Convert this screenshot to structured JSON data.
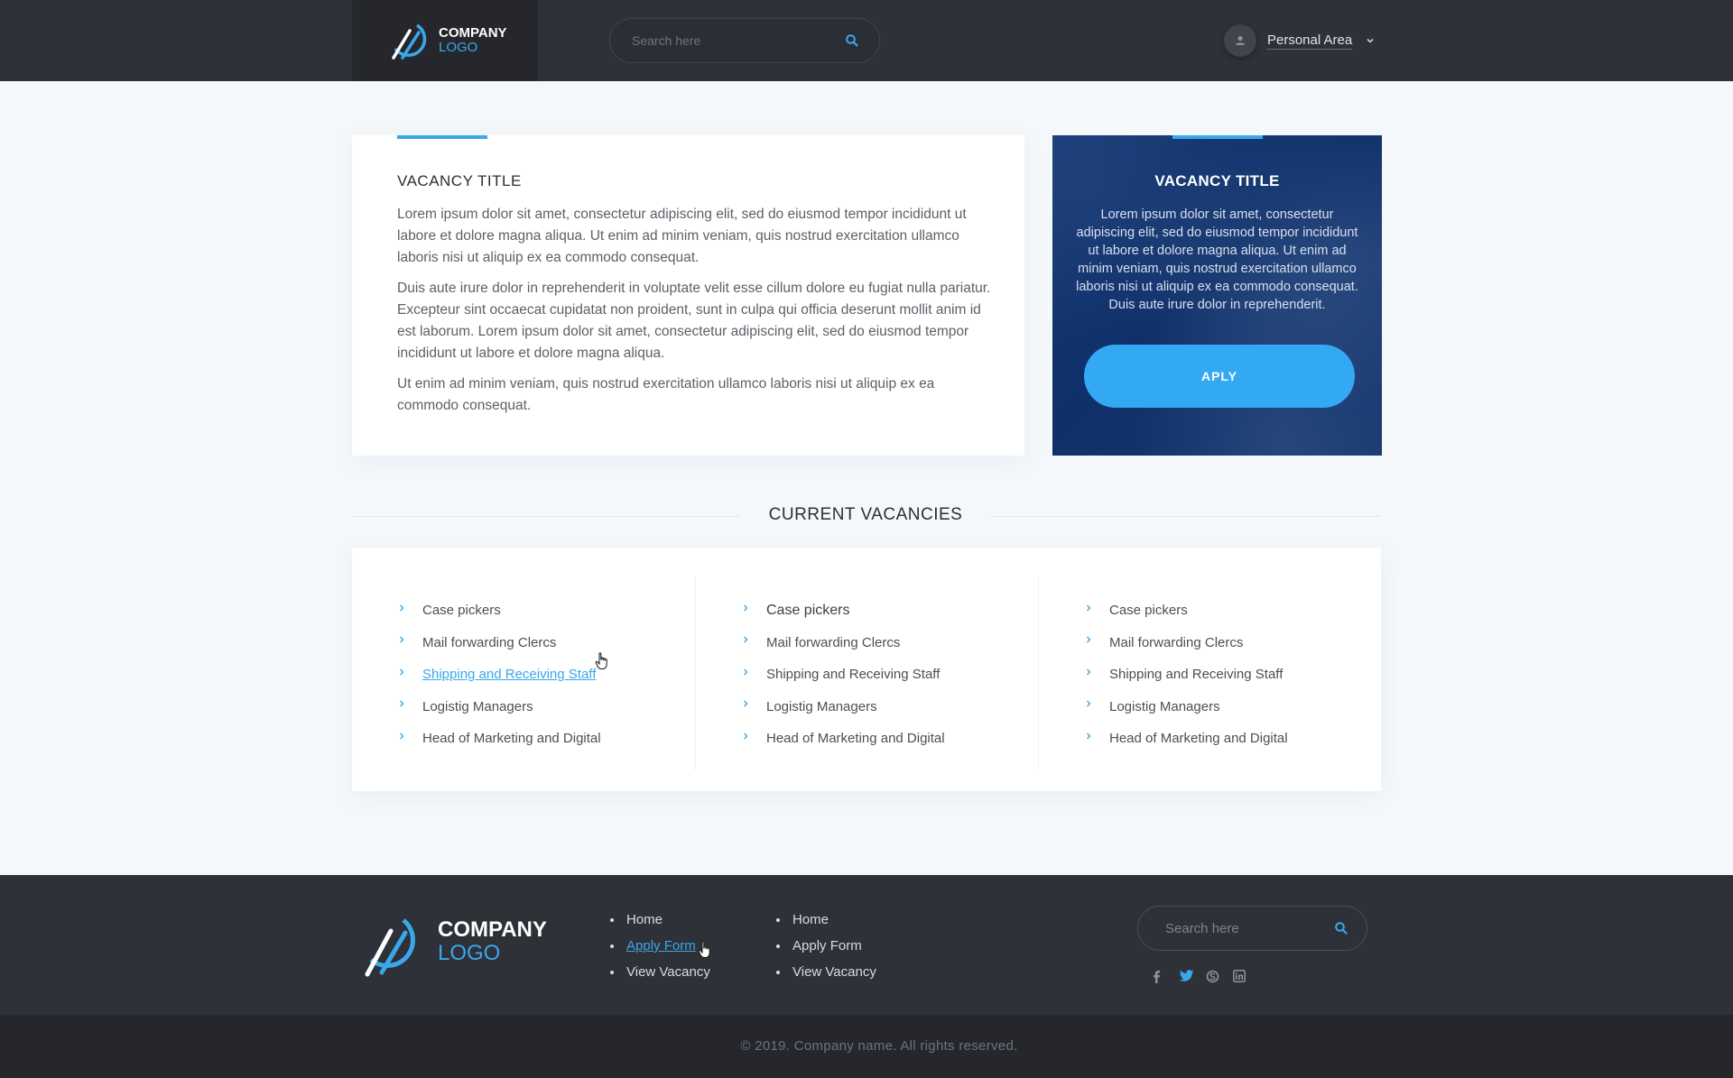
{
  "header": {
    "logo": {
      "line1": "COMPANY",
      "line2": "LOGO"
    },
    "search": {
      "placeholder": "Search here"
    },
    "personal_area": {
      "label": "Personal Area"
    }
  },
  "vacancy_card": {
    "title": "VACANCY TITLE",
    "paragraphs": [
      "Lorem ipsum dolor sit amet, consectetur adipiscing elit, sed do eiusmod tempor incididunt ut labore et dolore magna aliqua. Ut enim ad minim veniam, quis nostrud exercitation ullamco laboris nisi ut aliquip ex ea commodo consequat.",
      "Duis aute irure dolor in reprehenderit in voluptate velit esse cillum dolore eu fugiat nulla pariatur. Excepteur sint occaecat cupidatat non proident, sunt in culpa qui officia deserunt mollit anim id est laborum. Lorem ipsum dolor sit amet, consectetur adipiscing elit, sed do eiusmod tempor incididunt ut labore et dolore magna aliqua.",
      "Ut enim ad minim veniam, quis nostrud exercitation ullamco laboris nisi ut aliquip ex ea commodo consequat."
    ]
  },
  "apply_card": {
    "title": "VACANCY TITLE",
    "text": "Lorem ipsum dolor sit amet, consectetur adipiscing elit, sed do eiusmod tempor incididunt ut labore et dolore magna aliqua. Ut enim ad minim veniam, quis nostrud exercitation ullamco laboris nisi ut aliquip ex ea commodo consequat. Duis aute irure dolor in reprehenderit.",
    "button_label": "APLY"
  },
  "current_vacancies": {
    "title": "CURRENT VACANCIES",
    "columns": [
      [
        "Case pickers",
        "Mail forwarding Clercs",
        "Shipping and Receiving Staff",
        "Logistig Managers",
        "Head of Marketing and Digital"
      ],
      [
        "Case pickers",
        "Mail forwarding Clercs",
        "Shipping and Receiving Staff",
        "Logistig Managers",
        "Head of Marketing and Digital"
      ],
      [
        "Case pickers",
        "Mail forwarding Clercs",
        "Shipping and Receiving Staff",
        "Logistig Managers",
        "Head of Marketing and Digital"
      ]
    ]
  },
  "footer": {
    "logo": {
      "line1": "COMPANY",
      "line2": "LOGO"
    },
    "links_a": [
      "Home",
      "Apply Form",
      "View Vacancy"
    ],
    "links_b": [
      "Home",
      "Apply Form",
      "View Vacancy"
    ],
    "search": {
      "placeholder": "Search here"
    },
    "social_icons": [
      "facebook-icon",
      "twitter-icon",
      "skype-icon",
      "linkedin-icon"
    ],
    "copyright": "©  2019. Company name. All rights reserved."
  },
  "colors": {
    "accent": "#3aa7ea",
    "header_bg": "#2e3138",
    "footer_bottom_bg": "#25272c",
    "apply_card_bg": "#173a78"
  }
}
